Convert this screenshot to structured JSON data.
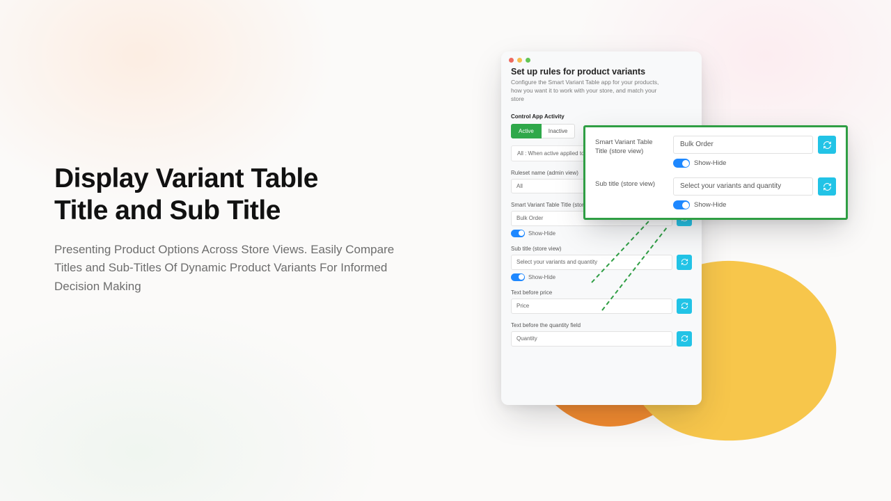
{
  "hero": {
    "title_l1": "Display Variant Table",
    "title_l2": "Title and Sub Title",
    "desc": "Presenting Product Options Across Store Views. Easily Compare Titles and Sub-Titles Of Dynamic Product Variants For Informed Decision Making"
  },
  "window": {
    "title": "Set up rules for product variants",
    "desc": "Configure the Smart Variant Table app for your products, how you want it to work with your store, and match your store",
    "section_label": "Control App Activity",
    "active_btn": "Active",
    "inactive_btn": "Inactive",
    "note": "All : When active applied to",
    "ruleset_label": "Ruleset name (admin view)",
    "ruleset_value": "All",
    "svt_title_label": "Smart Variant Table Title (store view)",
    "svt_title_value": "Bulk Order",
    "showhide": "Show-Hide",
    "subtitle_label": "Sub title (store view)",
    "subtitle_value": "Select your variants and quantity",
    "price_label": "Text before price",
    "price_value": "Price",
    "qty_label": "Text before the quantity field",
    "qty_value": "Quantity"
  },
  "callout": {
    "title_label": "Smart Variant Table Title (store view)",
    "title_value": "Bulk Order",
    "showhide": "Show-Hide",
    "sub_label": "Sub title (store view)",
    "sub_value": "Select your variants and quantity"
  }
}
